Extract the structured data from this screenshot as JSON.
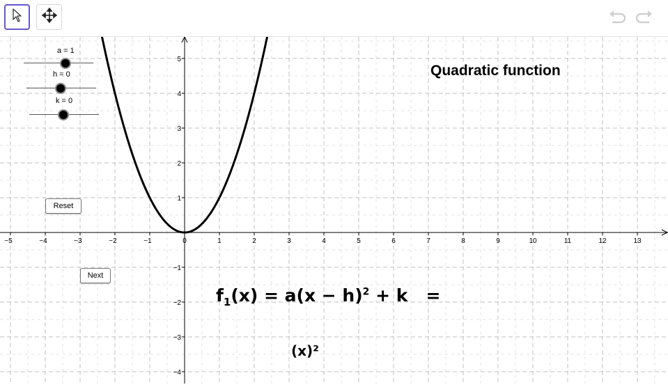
{
  "toolbar": {
    "tools": [
      {
        "icon": "pointer-arrow-icon",
        "selected": true
      },
      {
        "icon": "move-arrows-icon",
        "selected": false
      }
    ],
    "undo_icon": "undo-icon",
    "redo_icon": "redo-icon"
  },
  "sliders": [
    {
      "label": "a = 1",
      "value": 1
    },
    {
      "label": "h = 0",
      "value": 0
    },
    {
      "label": "k = 0",
      "value": 0
    }
  ],
  "buttons": {
    "reset": "Reset",
    "next": "Next"
  },
  "title": "Quadratic function",
  "formula": {
    "lhs_f": "f",
    "lhs_sub": "1",
    "lhs_arg": "(x) = a(x − h)",
    "sup": "2",
    "rhs": " + k   ="
  },
  "result": "(x)²",
  "chart_data": {
    "type": "line",
    "function": "f1(x) = a(x - h)^2 + k",
    "a": 1,
    "h": 0,
    "k": 0,
    "xlim": [
      -5.3,
      13.9
    ],
    "ylim": [
      -4.3,
      5.6
    ],
    "x_ticks": [
      "−5",
      "−4",
      "−3",
      "−2",
      "−1",
      "0",
      "1",
      "2",
      "3",
      "4",
      "5",
      "6",
      "7",
      "8",
      "9",
      "10",
      "11",
      "12",
      "13"
    ],
    "y_ticks": [
      "−4",
      "−3",
      "−2",
      "−1",
      "1",
      "2",
      "3",
      "4",
      "5"
    ],
    "grid": true,
    "series": [
      {
        "points_x": [
          -2.4,
          -2,
          -1.5,
          -1,
          -0.5,
          0,
          0.5,
          1,
          1.5,
          2,
          2.4
        ],
        "points_y": [
          5.76,
          4,
          2.25,
          1,
          0.25,
          0,
          0.25,
          1,
          2.25,
          4,
          5.76
        ]
      }
    ],
    "curve_color": "#000000",
    "axis_color": "#000000",
    "grid_color": "#c0c0c0"
  }
}
